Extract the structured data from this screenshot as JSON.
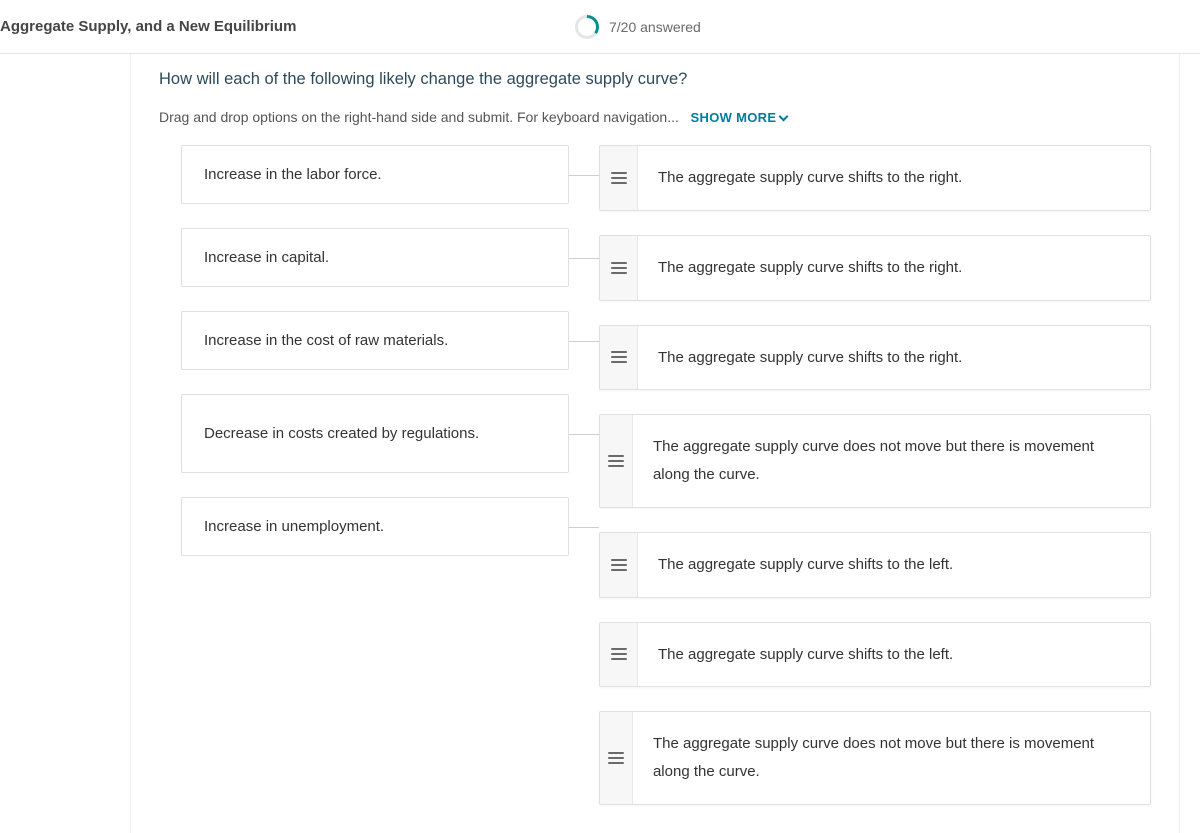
{
  "header": {
    "title": "Aggregate Supply, and a New Equilibrium",
    "progress": "7/20 answered"
  },
  "question": {
    "text": "How will each of the following likely change the aggregate supply curve?",
    "instructions": "Drag and drop options on the right-hand side and submit. For keyboard navigation...",
    "show_more": "SHOW MORE"
  },
  "prompts": [
    "Increase in the labor force.",
    "Increase in capital.",
    "Increase in the cost of raw materials.",
    "Decrease in costs created by regulations.",
    "Increase in unemployment."
  ],
  "answers": [
    "The aggregate supply curve shifts to the right.",
    "The aggregate supply curve shifts to the right.",
    "The aggregate supply curve shifts to the right.",
    "The aggregate supply curve does not move but there is movement along the curve.",
    "The aggregate supply curve shifts to the left.",
    "The aggregate supply curve shifts to the left.",
    "The aggregate supply curve does not move but there is movement along the curve."
  ]
}
